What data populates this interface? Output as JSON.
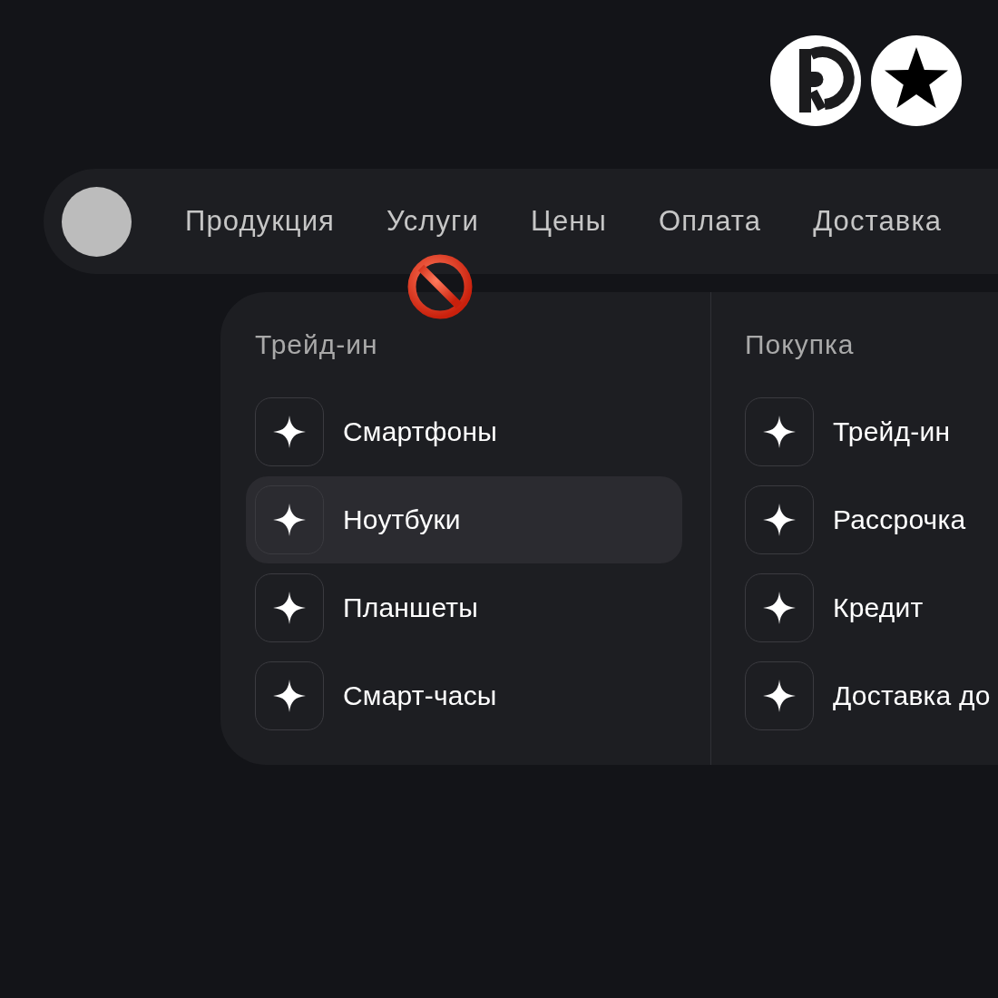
{
  "nav": {
    "items": [
      "Продукция",
      "Услуги",
      "Цены",
      "Оплата",
      "Доставка"
    ]
  },
  "dropdown": {
    "columns": [
      {
        "title": "Трейд-ин",
        "items": [
          {
            "label": "Смартфоны",
            "selected": false
          },
          {
            "label": "Ноутбуки",
            "selected": true
          },
          {
            "label": "Планшеты",
            "selected": false
          },
          {
            "label": "Смарт-часы",
            "selected": false
          }
        ]
      },
      {
        "title": "Покупка",
        "items": [
          {
            "label": "Трейд-ин",
            "selected": false
          },
          {
            "label": "Рассрочка",
            "selected": false
          },
          {
            "label": "Кредит",
            "selected": false
          },
          {
            "label": "Доставка до",
            "selected": false
          }
        ]
      }
    ]
  }
}
